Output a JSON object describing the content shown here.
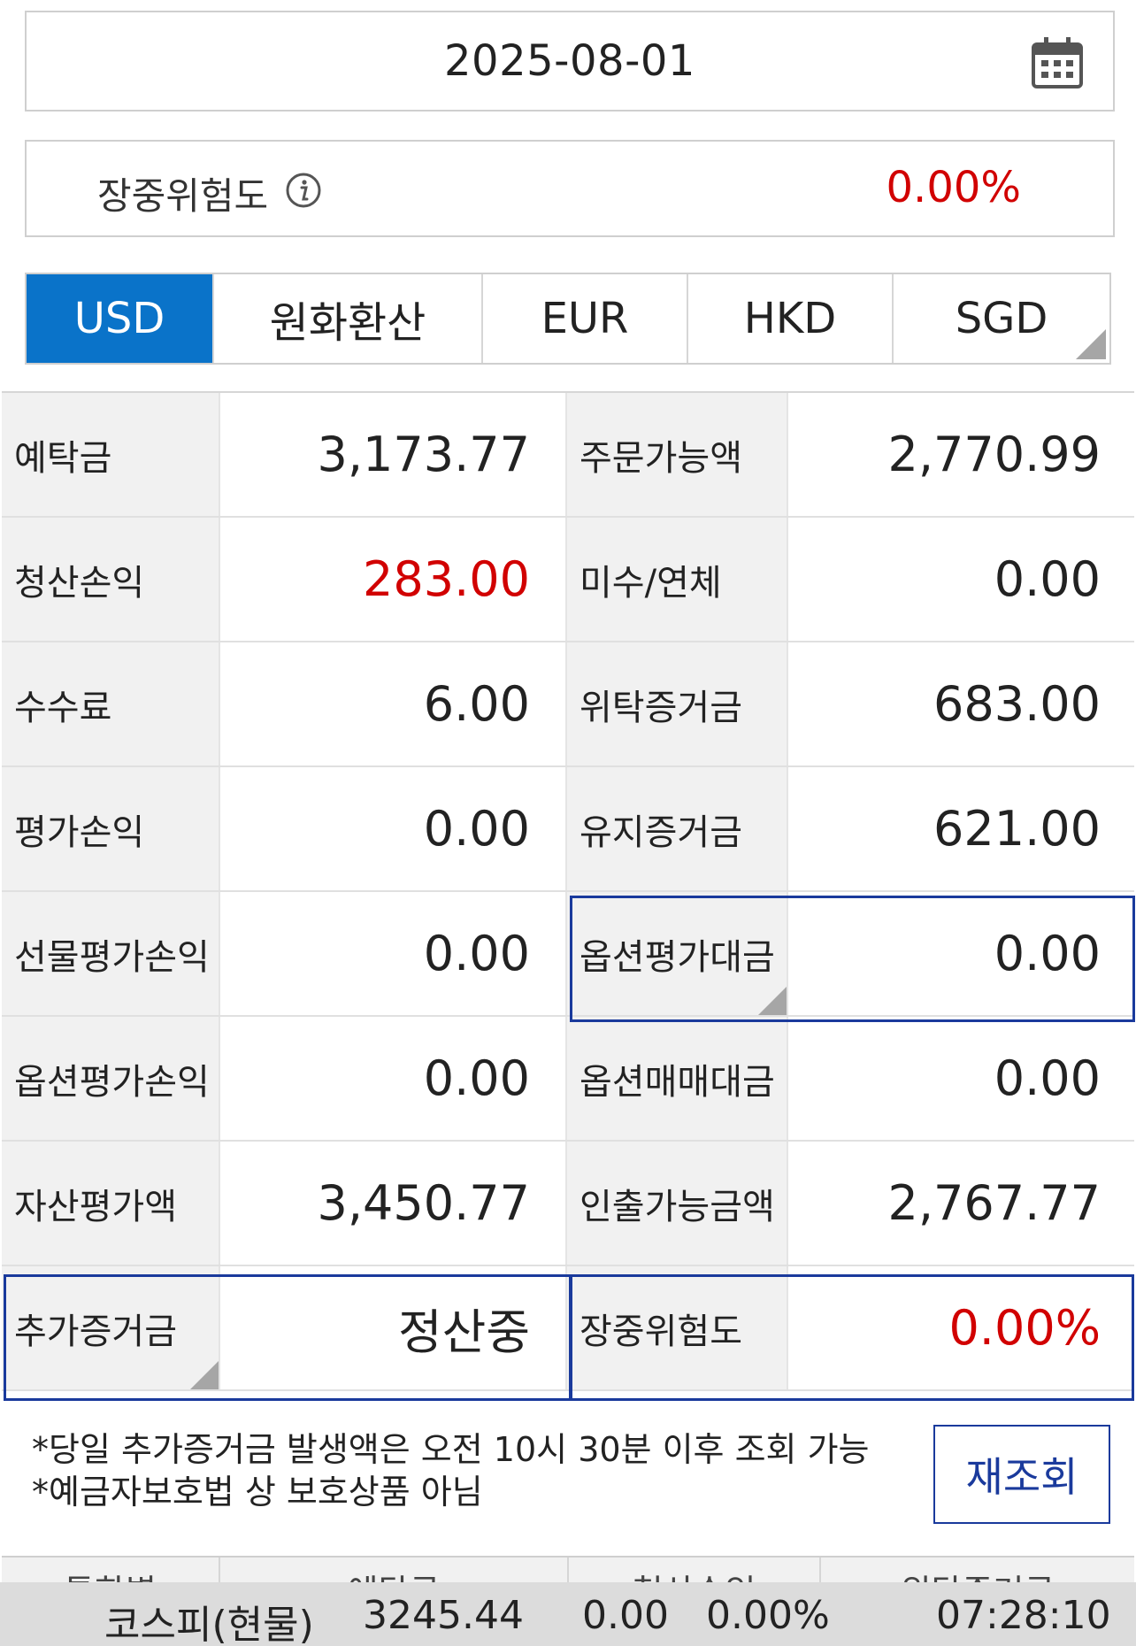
{
  "date_picker": {
    "value": "2025-08-01",
    "icon": "calendar-icon"
  },
  "risk": {
    "label": "장중위험도",
    "info_icon": "info-icon",
    "value": "0.00%"
  },
  "currency_tabs": [
    {
      "label": "USD",
      "active": true
    },
    {
      "label": "원화환산",
      "active": false
    },
    {
      "label": "EUR",
      "active": false
    },
    {
      "label": "HKD",
      "active": false
    },
    {
      "label": "SGD",
      "active": false
    }
  ],
  "grid": {
    "rows": [
      {
        "l1": "예탁금",
        "v1": "3,173.77",
        "l2": "주문가능액",
        "v2": "2,770.99"
      },
      {
        "l1": "청산손익",
        "v1": "283.00",
        "l2": "미수/연체",
        "v2": "0.00"
      },
      {
        "l1": "수수료",
        "v1": "6.00",
        "l2": "위탁증거금",
        "v2": "683.00"
      },
      {
        "l1": "평가손익",
        "v1": "0.00",
        "l2": "유지증거금",
        "v2": "621.00"
      },
      {
        "l1": "선물평가손익",
        "v1": "0.00",
        "l2": "옵션평가대금",
        "v2": "0.00"
      },
      {
        "l1": "옵션평가손익",
        "v1": "0.00",
        "l2": "옵션매매대금",
        "v2": "0.00"
      },
      {
        "l1": "자산평가액",
        "v1": "3,450.77",
        "l2": "인출가능금액",
        "v2": "2,767.77"
      },
      {
        "l1": "추가증거금",
        "v1": "정산중",
        "l2": "장중위험도",
        "v2": "0.00%"
      }
    ]
  },
  "notice": {
    "line1": "*당일 추가증거금 발생액은 오전 10시 30분 이후 조회 가능",
    "line2": "*예금자보호법 상 보호상품 아님"
  },
  "reload_button": {
    "label": "재조회"
  },
  "sub_table": {
    "headers": [
      "통화별",
      "예탁금",
      "청산손익",
      "위탁증거금"
    ]
  },
  "ticker": {
    "name": "코스피(현물)",
    "price": "3245.44",
    "change": "0.00",
    "change_pct": "0.00%",
    "time": "07:28:10"
  },
  "colors": {
    "accent": "#0a73c9",
    "negative_red": "#d10000",
    "highlight_border": "#1a3a9c"
  }
}
